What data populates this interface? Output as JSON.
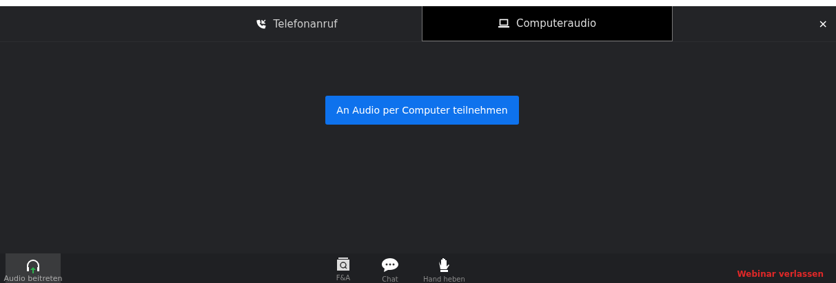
{
  "tabs": [
    {
      "label": "Telefonanruf",
      "kind": "phone",
      "selected": false
    },
    {
      "label": "Computeraudio",
      "kind": "computer",
      "selected": true
    }
  ],
  "close": "×",
  "join_button": "An Audio per Computer teilnehmen",
  "toolbar": {
    "audio": "Audio beitreten",
    "items": [
      {
        "label": "F&A",
        "kind": "qa"
      },
      {
        "label": "Chat",
        "kind": "chat"
      },
      {
        "label": "Hand heben",
        "kind": "hand"
      }
    ],
    "leave": "Webinar verlassen"
  }
}
